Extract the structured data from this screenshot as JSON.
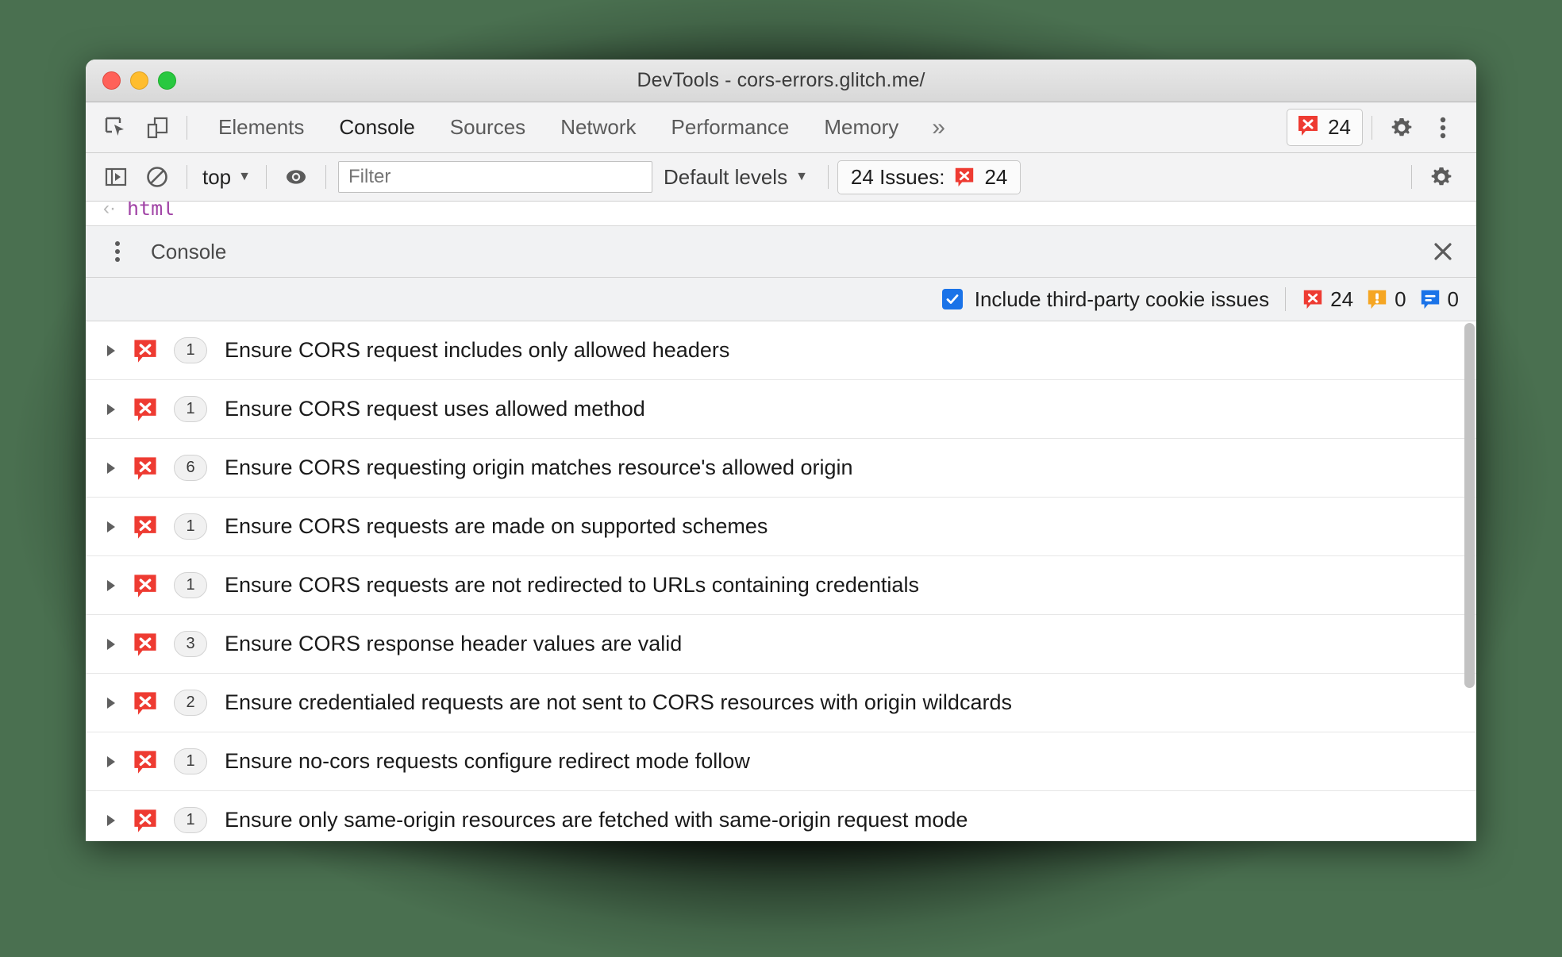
{
  "window": {
    "title": "DevTools - cors-errors.glitch.me/",
    "traffic_lights": [
      "close-red",
      "minimize-yellow",
      "zoom-green"
    ]
  },
  "tabstrip": {
    "icons": [
      "inspect-element-icon",
      "device-toolbar-icon"
    ],
    "tabs": [
      {
        "label": "Elements",
        "active": false
      },
      {
        "label": "Console",
        "active": true
      },
      {
        "label": "Sources",
        "active": false
      },
      {
        "label": "Network",
        "active": false
      },
      {
        "label": "Performance",
        "active": false
      },
      {
        "label": "Memory",
        "active": false
      }
    ],
    "more_label": "»",
    "error_badge": {
      "icon": "error-icon",
      "count": "24"
    },
    "settings_icon": "gear-icon",
    "menu_icon": "more-vertical-icon"
  },
  "console_toolbar": {
    "sidebar_toggle_icon": "console-sidebar-icon",
    "clear_icon": "clear-console-icon",
    "context_value": "top",
    "context_caret": "▼",
    "eye_icon": "live-expression-icon",
    "filter_placeholder": "Filter",
    "filter_value": "",
    "levels_label": "Default levels",
    "levels_caret": "▼",
    "issues_button": {
      "label": "24 Issues:",
      "icon": "error-icon",
      "count": "24"
    },
    "settings_icon": "gear-icon"
  },
  "console_output": {
    "return_arrow": "‹·",
    "value": "html"
  },
  "drawer": {
    "menu_icon": "more-vertical-icon",
    "tab_label": "Console",
    "close_icon": "close-icon"
  },
  "issues_options": {
    "checkbox_label": "Include third-party cookie issues",
    "checkbox_checked": true,
    "counters": [
      {
        "name": "errors",
        "icon": "error-icon",
        "value": "24",
        "color": "#ee3b32"
      },
      {
        "name": "warnings",
        "icon": "warning-icon",
        "value": "0",
        "color": "#f5a623"
      },
      {
        "name": "info",
        "icon": "info-icon",
        "value": "0",
        "color": "#1a73e8"
      }
    ]
  },
  "issues": [
    {
      "icon": "error-icon",
      "count": "1",
      "title": "Ensure CORS request includes only allowed headers"
    },
    {
      "icon": "error-icon",
      "count": "1",
      "title": "Ensure CORS request uses allowed method"
    },
    {
      "icon": "error-icon",
      "count": "6",
      "title": "Ensure CORS requesting origin matches resource's allowed origin"
    },
    {
      "icon": "error-icon",
      "count": "1",
      "title": "Ensure CORS requests are made on supported schemes"
    },
    {
      "icon": "error-icon",
      "count": "1",
      "title": "Ensure CORS requests are not redirected to URLs containing credentials"
    },
    {
      "icon": "error-icon",
      "count": "3",
      "title": "Ensure CORS response header values are valid"
    },
    {
      "icon": "error-icon",
      "count": "2",
      "title": "Ensure credentialed requests are not sent to CORS resources with origin wildcards"
    },
    {
      "icon": "error-icon",
      "count": "1",
      "title": "Ensure no-cors requests configure redirect mode follow"
    },
    {
      "icon": "error-icon",
      "count": "1",
      "title": "Ensure only same-origin resources are fetched with same-origin request mode"
    }
  ],
  "colors": {
    "error_red": "#ee3b32",
    "warning_orange": "#f5a623",
    "info_blue": "#1a73e8",
    "accent_blue": "#1a73e8",
    "backdrop_green": "#4a7050"
  }
}
